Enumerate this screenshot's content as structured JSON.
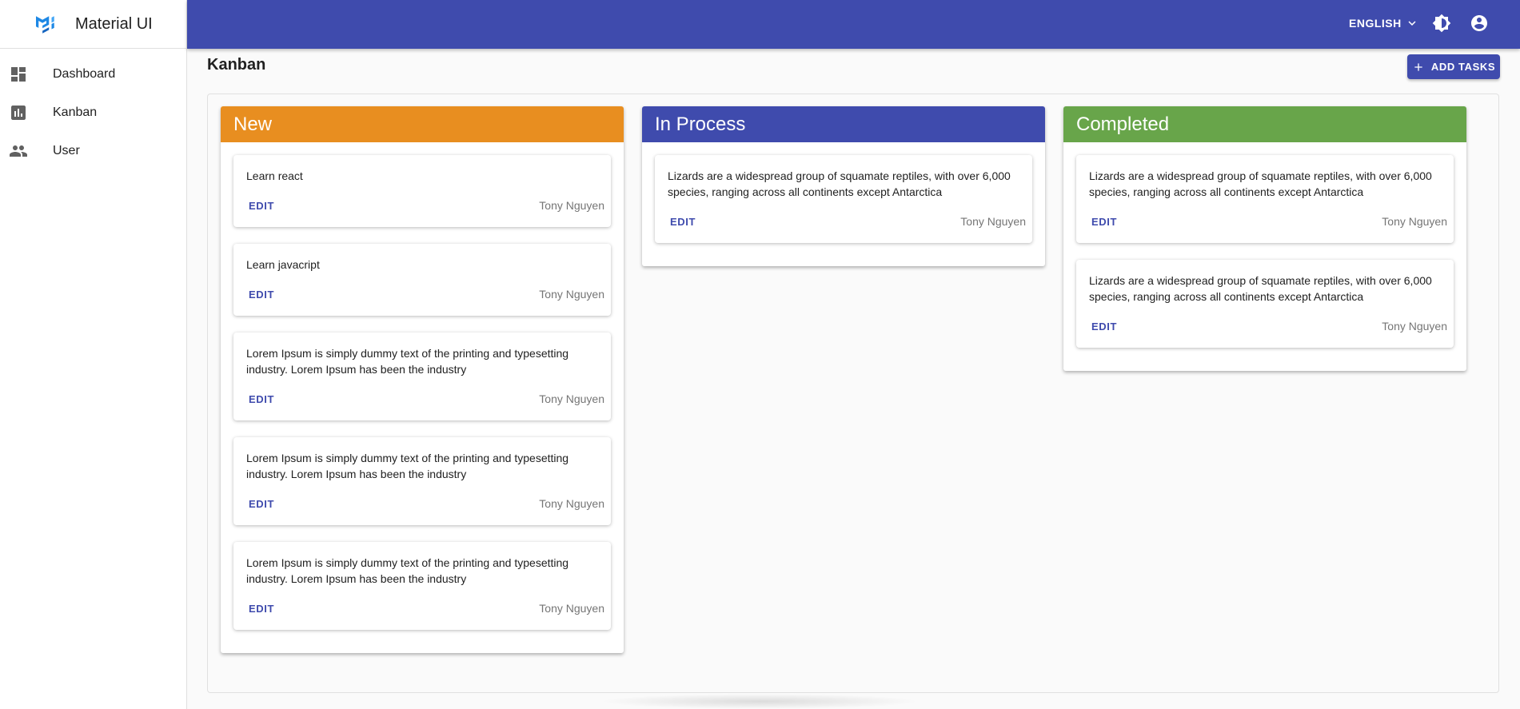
{
  "app": {
    "brand": "Material UI",
    "accent": "#3f4bad"
  },
  "sidebar": {
    "items": [
      {
        "label": "Dashboard",
        "icon": "dashboard-icon"
      },
      {
        "label": "Kanban",
        "icon": "bar-chart-icon"
      },
      {
        "label": "User",
        "icon": "people-icon"
      }
    ]
  },
  "appbar": {
    "language": "ENGLISH",
    "icons": [
      "chevron-down-icon",
      "brightness-icon",
      "account-circle-icon"
    ]
  },
  "page": {
    "title": "Kanban",
    "add_button": "ADD TASKS"
  },
  "columns": [
    {
      "title": "New",
      "color": "#e88e20",
      "cards": [
        {
          "text": "Learn react",
          "edit": "EDIT",
          "author": "Tony Nguyen"
        },
        {
          "text": "Learn javacript",
          "edit": "EDIT",
          "author": "Tony Nguyen"
        },
        {
          "text": "Lorem Ipsum is simply dummy text of the printing and typesetting industry. Lorem Ipsum has been the industry",
          "edit": "EDIT",
          "author": "Tony Nguyen"
        },
        {
          "text": "Lorem Ipsum is simply dummy text of the printing and typesetting industry. Lorem Ipsum has been the industry",
          "edit": "EDIT",
          "author": "Tony Nguyen"
        },
        {
          "text": "Lorem Ipsum is simply dummy text of the printing and typesetting industry. Lorem Ipsum has been the industry",
          "edit": "EDIT",
          "author": "Tony Nguyen"
        }
      ]
    },
    {
      "title": "In Process",
      "color": "#3f4bad",
      "cards": [
        {
          "text": "Lizards are a widespread group of squamate reptiles, with over 6,000 species, ranging across all continents except Antarctica",
          "edit": "EDIT",
          "author": "Tony Nguyen"
        }
      ]
    },
    {
      "title": "Completed",
      "color": "#68a54a",
      "cards": [
        {
          "text": "Lizards are a widespread group of squamate reptiles, with over 6,000 species, ranging across all continents except Antarctica",
          "edit": "EDIT",
          "author": "Tony Nguyen"
        },
        {
          "text": "Lizards are a widespread group of squamate reptiles, with over 6,000 species, ranging across all continents except Antarctica",
          "edit": "EDIT",
          "author": "Tony Nguyen"
        }
      ]
    }
  ]
}
